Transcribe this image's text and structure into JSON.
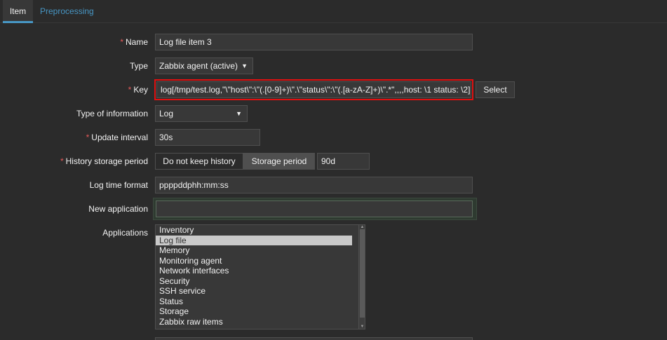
{
  "tabs": [
    {
      "label": "Item",
      "active": true
    },
    {
      "label": "Preprocessing",
      "active": false
    }
  ],
  "form": {
    "name": {
      "label": "Name",
      "required": true,
      "value": "Log file item 3"
    },
    "type": {
      "label": "Type",
      "value": "Zabbix agent (active)"
    },
    "key": {
      "label": "Key",
      "required": true,
      "value": "log[/tmp/test.log,\"\\\"host\\\":\\\"(.[0-9]+)\\\".\\\"status\\\":\\\"(.[a-zA-Z]+)\\\".*\",,,,host: \\1 status: \\2]",
      "select_label": "Select"
    },
    "type_of_information": {
      "label": "Type of information",
      "value": "Log"
    },
    "update_interval": {
      "label": "Update interval",
      "required": true,
      "value": "30s"
    },
    "history": {
      "label": "History storage period",
      "required": true,
      "option_off": "Do not keep history",
      "option_on": "Storage period",
      "value": "90d"
    },
    "log_time_format": {
      "label": "Log time format",
      "value": "ppppddphh:mm:ss"
    },
    "new_application": {
      "label": "New application",
      "value": ""
    },
    "applications": {
      "label": "Applications",
      "options": [
        "Inventory",
        "Log file",
        "Memory",
        "Monitoring agent",
        "Network interfaces",
        "Security",
        "SSH service",
        "Status",
        "Storage",
        "Zabbix raw items"
      ],
      "selected": "Log file"
    }
  },
  "colors": {
    "background": "#2b2b2b",
    "accent": "#4796c4",
    "required": "#e45959",
    "highlight_border": "#e01010"
  }
}
